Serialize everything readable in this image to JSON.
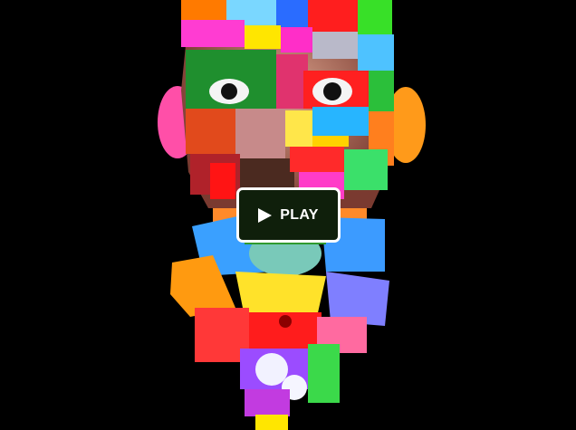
{
  "player": {
    "play_label": "PLAY",
    "play_icon": "play-triangle-icon",
    "colors": {
      "background": "#000000",
      "button_bg": "#0f1f0b",
      "button_border": "#ffffff"
    }
  },
  "artwork": {
    "style": "psychedelic collage portrait",
    "palette": [
      "#ff2d2d",
      "#ff8a00",
      "#ffe600",
      "#32d21e",
      "#17b3ff",
      "#ff3cc8",
      "#7b3cff",
      "#d9d9d9"
    ]
  }
}
